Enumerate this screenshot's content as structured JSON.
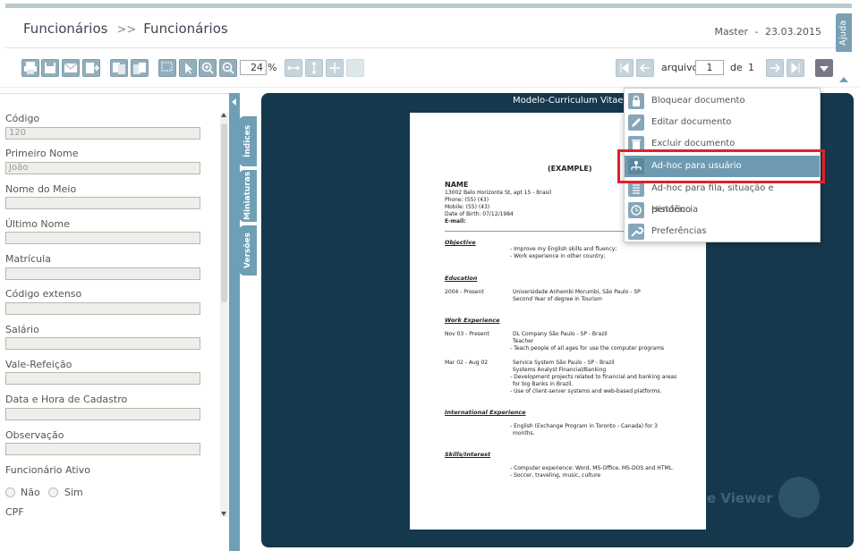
{
  "header": {
    "breadcrumb": [
      "Funcionários",
      ">>",
      "Funcionários"
    ],
    "user": "Master",
    "date_sep": "-",
    "date": "23.03.2015",
    "help_tab": "Ajuda"
  },
  "toolbar": {
    "zoom_value": "24",
    "zoom_unit": "%",
    "arquivo_label": "arquivo",
    "arquivo_value": "1",
    "de_label": "de",
    "total": "1"
  },
  "form": {
    "fields": [
      {
        "label": "Código",
        "value": "120"
      },
      {
        "label": "Primeiro Nome",
        "value": "João"
      },
      {
        "label": "Nome do Meio",
        "value": ""
      },
      {
        "label": "Último Nome",
        "value": ""
      },
      {
        "label": "Matrícula",
        "value": ""
      },
      {
        "label": "Código extenso",
        "value": ""
      },
      {
        "label": "Salário",
        "value": ""
      },
      {
        "label": "Vale-Refeição",
        "value": ""
      },
      {
        "label": "Data e Hora de Cadastro",
        "value": ""
      },
      {
        "label": "Observação",
        "value": ""
      }
    ],
    "ativo_label": "Funcionário Ativo",
    "opt_nao": "Não",
    "opt_sim": "Sim",
    "cpf_label": "CPF"
  },
  "side_tabs": [
    "Índices",
    "Miniaturas",
    "Versões"
  ],
  "viewer": {
    "title": "Modelo-Curriculum Vitae-4",
    "watermark": "e Viewer"
  },
  "document": {
    "example": "(EXAMPLE)",
    "name": "NAME",
    "address": "13002 Belo Horizonte St, apt 15 - Brasil",
    "phone": "Phone: (55) (43)",
    "mobile": "Mobile: (55) (43)",
    "dob": "Date of Birth: 07/12/1984",
    "email": "E-mail:",
    "objective_title": "Objective",
    "objective_1": "- Improve my English skills and fluency;",
    "objective_2": "- Work experience in other country;",
    "education_title": "Education",
    "edu_period": "2004 - Present",
    "edu_1": "Universidade Anhembi Morumbi, São Paulo - SP",
    "edu_2": "Second Year of degree in Tourism",
    "work_title": "Work Experience",
    "w1_period": "Nov 03 - Present",
    "w1_1": "DL Company São Paulo - SP - Brazil",
    "w1_2": "Teacher",
    "w1_3": "- Teach people of all ages for use the computer programs",
    "w2_period": "Mar 02 - Aug 02",
    "w2_1": "Service System São Paulo - SP - Brazil",
    "w2_2": "Systems Analyst Financial/Banking",
    "w2_3": "- Development projects related to financial and banking areas",
    "w2_4": "for big Banks in Brazil.",
    "w2_5": "- Use of client-server systems and web-based platforms.",
    "intl_title": "International Experience",
    "intl_1": "- English (Exchange Program in Toronto - Canada) for 3",
    "intl_2": "months.",
    "skills_title": "Skills/Interest",
    "skills_1": "- Computer experience: Word, MS-Office, MS-DOS and HTML.",
    "skills_2": "- Soccer, traveling, music, culture"
  },
  "menu": {
    "items": [
      {
        "label": "Bloquear documento",
        "icon": "lock-icon"
      },
      {
        "label": "Editar documento",
        "icon": "pencil-icon"
      },
      {
        "label": "Excluir documento",
        "icon": "trash-icon"
      },
      {
        "label": "Ad-hoc para usuário",
        "icon": "user-tree-icon"
      },
      {
        "label": "Ad-hoc para fila, situação e pendência",
        "icon": "list-icon"
      },
      {
        "label": "Histórico",
        "icon": "clock-icon"
      },
      {
        "label": "Preferências",
        "icon": "wrench-icon"
      }
    ],
    "selected_index": 3
  }
}
